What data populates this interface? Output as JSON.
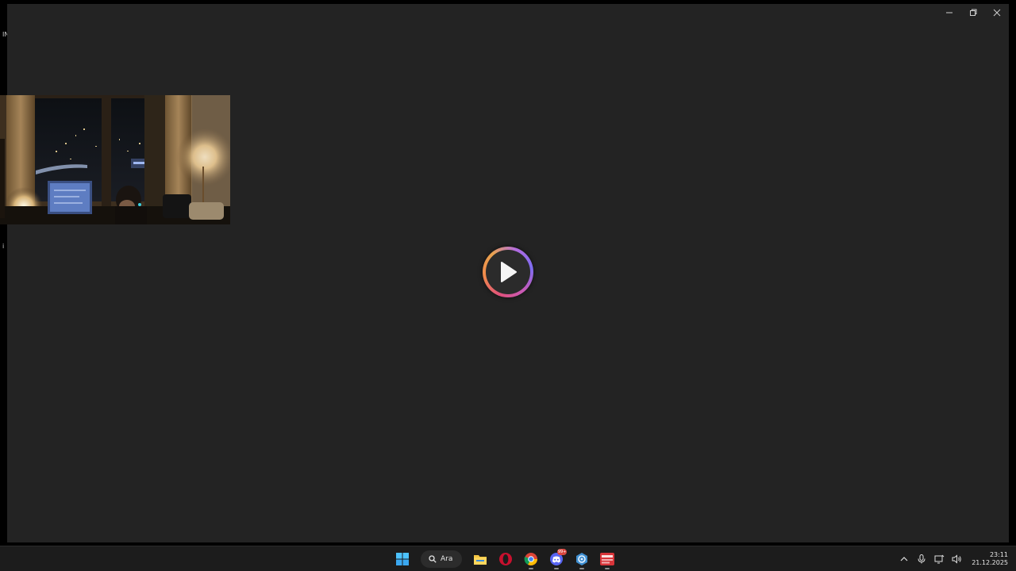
{
  "window": {
    "controls": {
      "minimize_icon": "minimize-icon",
      "maximize_icon": "restore-icon",
      "close_icon": "close-icon"
    },
    "background_color": "#232323"
  },
  "player": {
    "play_icon": "play-icon",
    "ring_colors": [
      "#e0517b",
      "#f08a4b",
      "#b26be0",
      "#7d6cf0"
    ]
  },
  "edge_glyphs": {
    "top": "IN",
    "bottom": "i"
  },
  "webcam": {
    "description_icon": "webcam-feed"
  },
  "taskbar": {
    "start_icon": "windows-start-icon",
    "search": {
      "label": "Ara",
      "icon": "search-icon"
    },
    "apps": [
      {
        "name": "file-explorer-icon"
      },
      {
        "name": "opera-icon"
      },
      {
        "name": "chrome-icon"
      },
      {
        "name": "discord-icon",
        "badge": "99+"
      },
      {
        "name": "app-settings-icon"
      },
      {
        "name": "video-writer-icon"
      }
    ],
    "tray": {
      "chevron": "chevron-up-icon",
      "mic": "microphone-icon",
      "network": "network-icon",
      "volume": "volume-icon"
    },
    "clock": {
      "time": "23:11",
      "date": "21.12.2025"
    }
  }
}
